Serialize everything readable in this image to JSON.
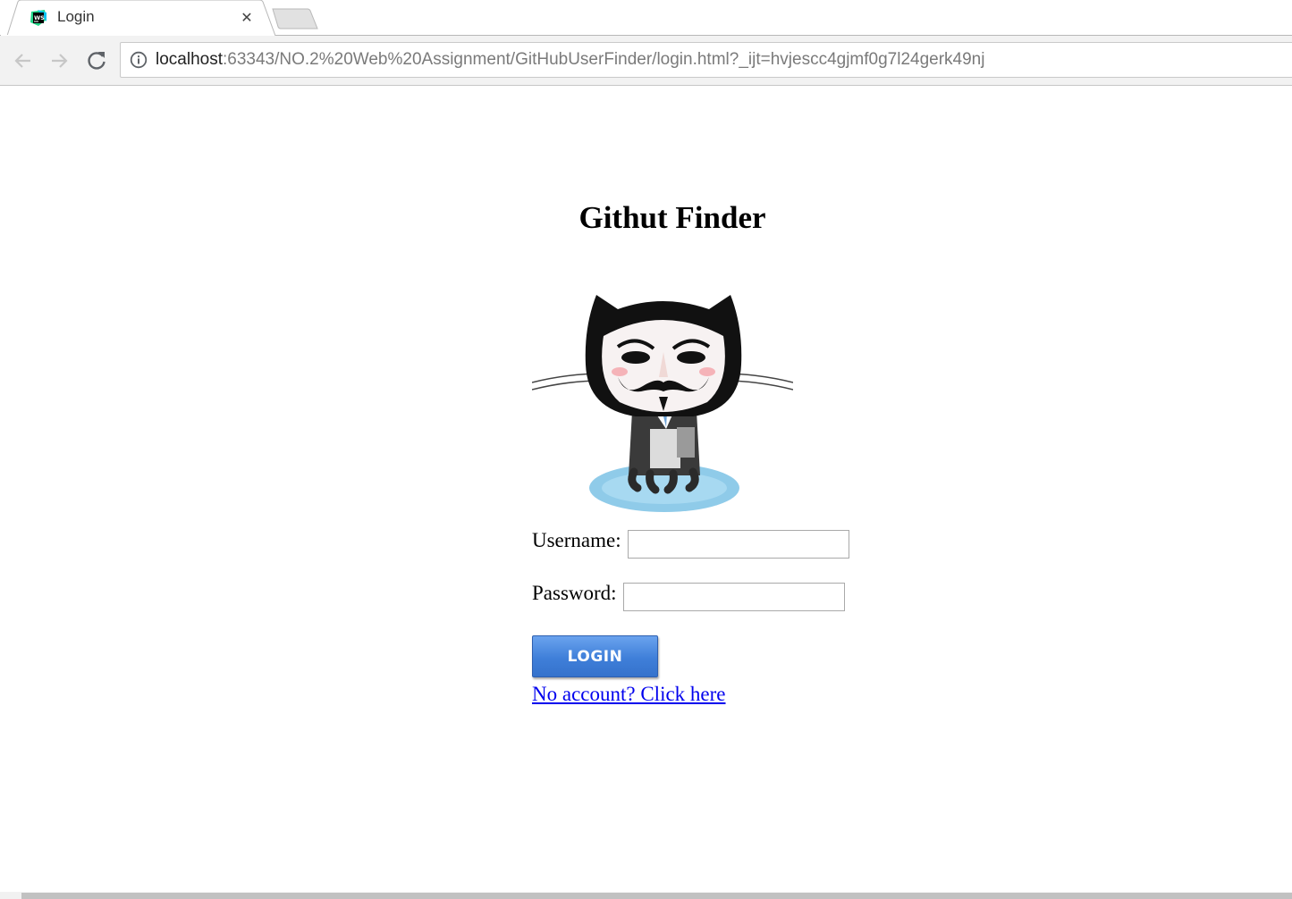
{
  "browser": {
    "tab": {
      "title": "Login",
      "close_glyph": "✕",
      "favicon": "webstorm-ws-icon"
    },
    "toolbar": {
      "back_icon": "arrow-left-icon",
      "forward_icon": "arrow-right-icon",
      "reload_icon": "reload-icon",
      "info_icon": "info-icon"
    },
    "address": {
      "host": "localhost",
      "rest": ":63343/NO.2%20Web%20Assignment/GitHubUserFinder/login.html?_ijt=hvjescc4gjmf0g7l24gerk49nj"
    }
  },
  "page": {
    "title": "Githut Finder",
    "mascot_icon": "anonymous-octocat-logo",
    "form": {
      "username_label": "Username:",
      "username_value": "",
      "password_label": "Password:",
      "password_value": "",
      "login_label": "LOGIN",
      "signup_link": "No account? Click here"
    }
  },
  "colors": {
    "link": "#0000ee",
    "login_button": "#3f7fd9",
    "mascot_water": "#8fcbe9"
  }
}
